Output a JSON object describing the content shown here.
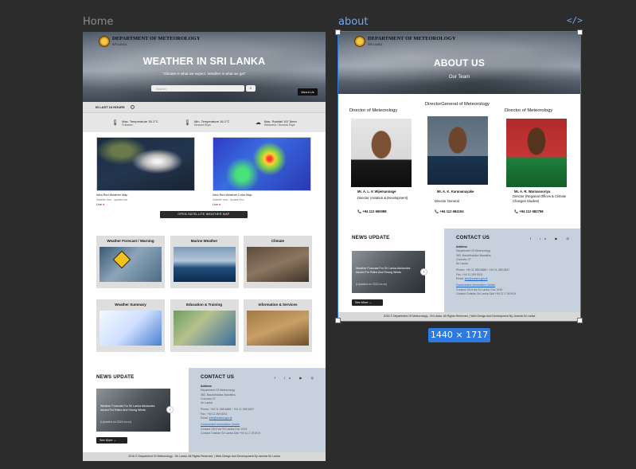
{
  "canvas": {
    "frames": [
      "Home",
      "about"
    ],
    "size_badge": "1440 × 1717"
  },
  "brand": {
    "dept": "DEPARTMENT OF METEOROLOGY",
    "sub": "SRI LANKA"
  },
  "home": {
    "hero": {
      "title": "WEATHER IN SRI LANKA",
      "tagline": "\"Climate is what we expect, Weather is what we get\"",
      "search_placeholder": "Search",
      "about_button": "About Us"
    },
    "last24_label": "IN LAST 24 HOURS",
    "stats": [
      {
        "label": "Max. Temperature 30.1°C",
        "place": "Puttalam"
      },
      {
        "label": "Min. Temperature 16.1°C",
        "place": "Nuwara Eliya"
      },
      {
        "label": "Max. Rainfall 167.5mm",
        "place": "Walawela / Nuwara Eliya"
      }
    ],
    "satellite": [
      {
        "title": "Infra Red Weather Map",
        "sub": "Satellite View - updated live",
        "live": "Live"
      },
      {
        "title": "Infra Red Weather Color Map",
        "sub": "Satellite View - Updated live",
        "live": "Live"
      }
    ],
    "satellite_button": "OPEN SATELLITE WEATHER MAP",
    "cards_row1": [
      "Weather Forecast / Warning",
      "Marine Weather",
      "Climate"
    ],
    "cards_row2": [
      "Weather Summary",
      "Education & Training",
      "Information & Services"
    ]
  },
  "about": {
    "title": "ABOUT US",
    "subtitle": "Our Team",
    "members": [
      {
        "role": "Director of Meteorology",
        "name": "Mr. A. L. K Wijemannage",
        "position": "Director (Aviation & Development)",
        "phone": "+94 112 665088"
      },
      {
        "role": "DirectorGeneral of Meteorology",
        "name": "Mr. A. K. Karunanayake",
        "position": "Director General",
        "phone": "+94 112 684104"
      },
      {
        "role": "Director of Meteorology",
        "name": "Mr. A. R. Warnasooriya",
        "position": "Director (Regional Offices & Climate Changes Studies)",
        "phone": "+94 112 682758"
      }
    ]
  },
  "news": {
    "title": "NEWS UPDATE",
    "headline": "Weather Forecast For Sri Lanka Advisories Issued For Rains And Strong Winds",
    "date": "(Updated on 2024.xx.xx)",
    "see_more": "See More"
  },
  "contact": {
    "title": "CONTACT US",
    "address_label": "Address",
    "address": [
      "Department Of Meteorology",
      "383, Bauddhaloka Mawatha,",
      "Colombo 07",
      "Sri Lanka"
    ],
    "phone": "Phone: +94 11 268 6686 / +94 11 268 4847",
    "fax": "Fax: +94 11 269 8311",
    "email_label": "Email:",
    "email": "info@meteo.gov.lk",
    "center": "Government Information Center",
    "center_lines": [
      "Contact 1919 via Sri Lanka Gov 1919",
      "Contact Outside Sri Lanka Dial +94 11 2 191919"
    ]
  },
  "footer": {
    "text": "2016 © Department Of Meteorology - Sri Lanka. All Rights Reserved. | Web Design And Development By Janeda Sri Lanka"
  },
  "colors": {
    "selection": "#2d7be0",
    "contact_bg": "#c6d1dd"
  }
}
